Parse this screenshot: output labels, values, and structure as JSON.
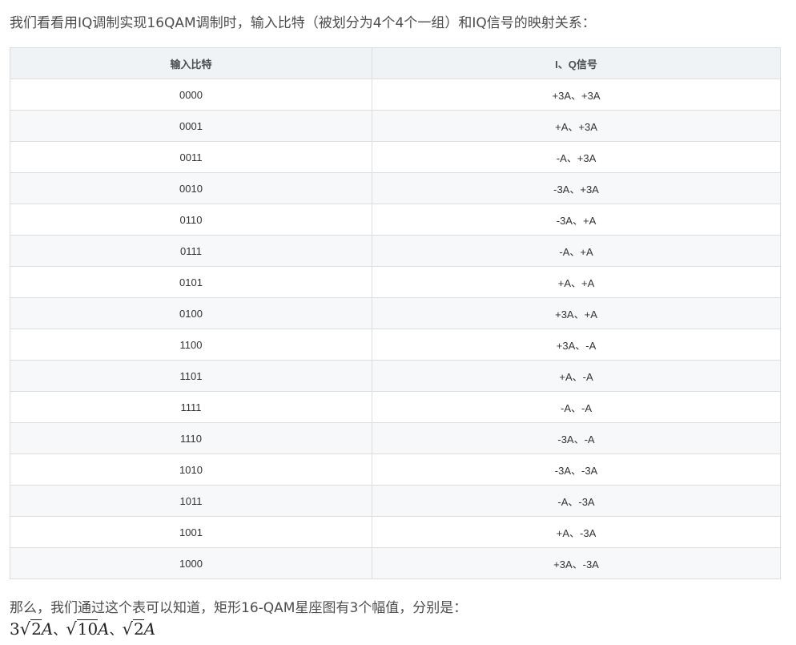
{
  "intro_text": "我们看看用IQ调制实现16QAM调制时，输入比特（被划分为4个4个一组）和IQ信号的映射关系：",
  "table": {
    "headers": [
      "输入比特",
      "I、Q信号"
    ],
    "rows": [
      [
        "0000",
        "+3A、+3A"
      ],
      [
        "0001",
        "+A、+3A"
      ],
      [
        "0011",
        "-A、+3A"
      ],
      [
        "0010",
        "-3A、+3A"
      ],
      [
        "0110",
        "-3A、+A"
      ],
      [
        "0111",
        "-A、+A"
      ],
      [
        "0101",
        "+A、+A"
      ],
      [
        "0100",
        "+3A、+A"
      ],
      [
        "1100",
        "+3A、-A"
      ],
      [
        "1101",
        "+A、-A"
      ],
      [
        "1111",
        "-A、-A"
      ],
      [
        "1110",
        "-3A、-A"
      ],
      [
        "1010",
        "-3A、-3A"
      ],
      [
        "1011",
        "-A、-3A"
      ],
      [
        "1001",
        "+A、-3A"
      ],
      [
        "1000",
        "+3A、-3A"
      ]
    ]
  },
  "outro_text": "那么，我们通过这个表可以知道，矩形16-QAM星座图有3个幅值，分别是：",
  "formula": {
    "term1_coef": "3",
    "term1_radicand": "2",
    "term2_radicand": "10",
    "term3_radicand": "2",
    "symbol": "A",
    "separator": "、"
  },
  "colors": {
    "header_bg": "#eff3f5",
    "stripe_bg": "#f7f8f9",
    "border": "#dddddd",
    "text": "#4d4d4d"
  }
}
